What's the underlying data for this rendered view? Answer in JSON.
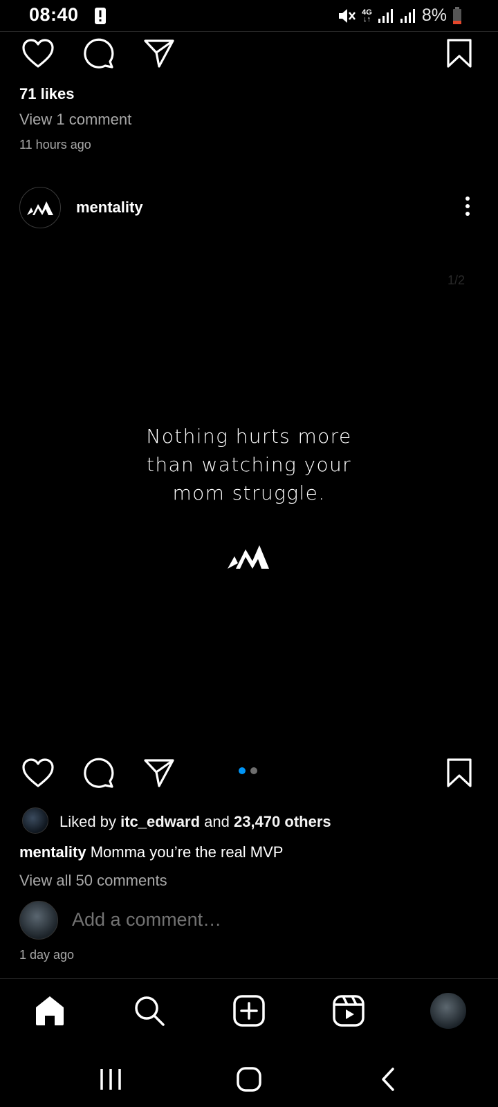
{
  "status": {
    "time": "08:40",
    "network": "4G",
    "battery": "8%"
  },
  "top_post": {
    "likes": "71 likes",
    "view_comments": "View 1 comment",
    "time": "11 hours ago"
  },
  "post": {
    "username": "mentality",
    "counter": "1/2",
    "quote_lines": [
      "Nothing hurts more",
      "than watching your",
      "mom struggle."
    ],
    "liked_by_prefix": "Liked by",
    "liked_by_user": "itc_edward",
    "liked_by_and": "and",
    "liked_by_others": "23,470 others",
    "caption_user": "mentality",
    "caption_text": "Momma you’re the real MVP",
    "view_all": "View all 50 comments",
    "comment_placeholder": "Add a comment…",
    "time": "1 day ago"
  },
  "colors": {
    "accent": "#0095f6",
    "muted": "#a8a8a8",
    "background": "#000000"
  },
  "icons": {
    "actions": [
      "heart-icon",
      "comment-icon",
      "share-icon",
      "bookmark-icon"
    ],
    "nav": [
      "home-icon",
      "search-icon",
      "create-icon",
      "reels-icon",
      "profile-avatar"
    ],
    "system": [
      "recents-icon",
      "home-circle-icon",
      "back-icon"
    ]
  }
}
